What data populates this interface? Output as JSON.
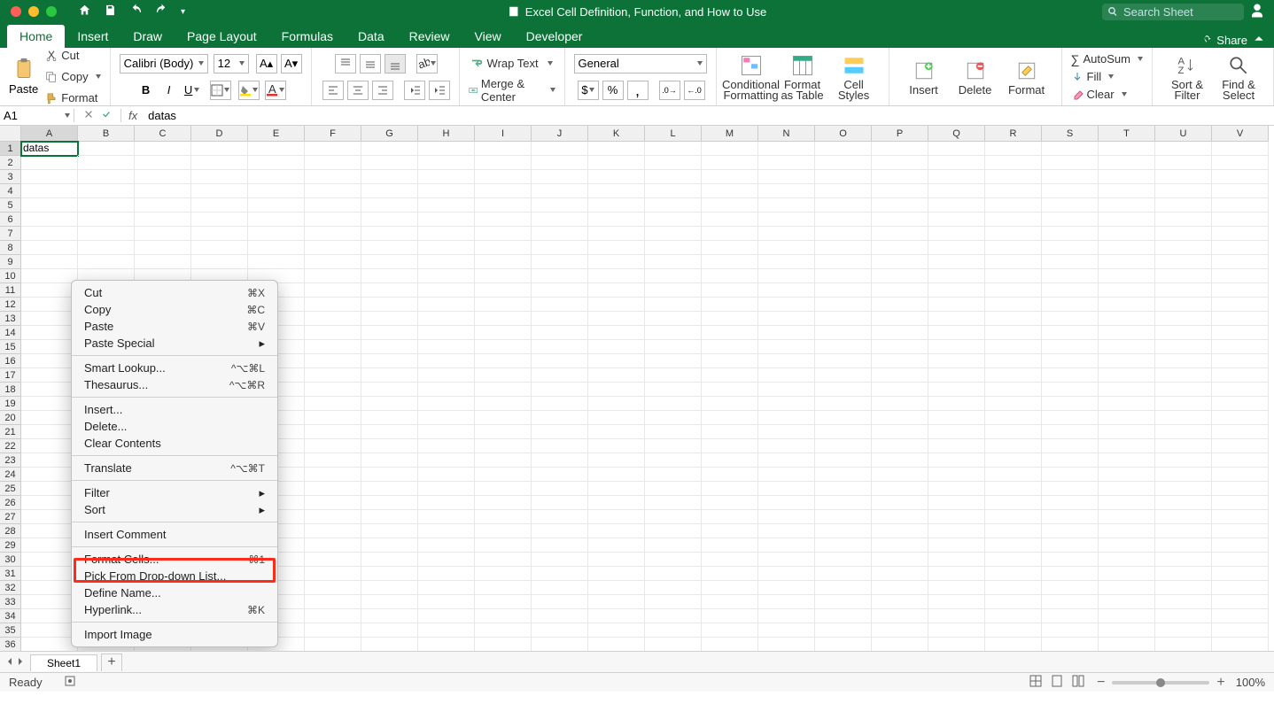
{
  "titlebar": {
    "title": "Excel Cell Definition, Function, and How to Use",
    "search_placeholder": "Search Sheet"
  },
  "tabs": [
    "Home",
    "Insert",
    "Draw",
    "Page Layout",
    "Formulas",
    "Data",
    "Review",
    "View",
    "Developer"
  ],
  "tabs_right": {
    "share": "Share"
  },
  "clipboard": {
    "paste": "Paste",
    "cut": "Cut",
    "copy": "Copy",
    "format": "Format"
  },
  "font": {
    "name": "Calibri (Body)",
    "size": "12"
  },
  "alignment": {
    "wrap": "Wrap Text",
    "merge": "Merge & Center"
  },
  "number": {
    "format": "General"
  },
  "styles": {
    "cond": "Conditional Formatting",
    "table": "Format as Table",
    "cell": "Cell Styles"
  },
  "cells": {
    "insert": "Insert",
    "delete": "Delete",
    "format": "Format"
  },
  "editing": {
    "autosum": "AutoSum",
    "fill": "Fill",
    "clear": "Clear",
    "sort": "Sort & Filter",
    "find": "Find & Select"
  },
  "formula_bar": {
    "name_box": "A1",
    "value": "datas"
  },
  "columns": [
    "A",
    "B",
    "C",
    "D",
    "E",
    "F",
    "G",
    "H",
    "I",
    "J",
    "K",
    "L",
    "M",
    "N",
    "O",
    "P",
    "Q",
    "R",
    "S",
    "T",
    "U",
    "V"
  ],
  "cell_A1": "datas",
  "context_menu": {
    "cut": "Cut",
    "cut_sc": "⌘X",
    "copy": "Copy",
    "copy_sc": "⌘C",
    "pastev": "Paste",
    "paste_sc": "⌘V",
    "paste_special": "Paste Special",
    "smart": "Smart Lookup...",
    "smart_sc": "^⌥⌘L",
    "thes": "Thesaurus...",
    "thes_sc": "^⌥⌘R",
    "insert": "Insert...",
    "delete": "Delete...",
    "clear": "Clear Contents",
    "translate": "Translate",
    "translate_sc": "^⌥⌘T",
    "filter": "Filter",
    "sort": "Sort",
    "comment": "Insert Comment",
    "format_cells": "Format Cells...",
    "format_cells_sc": "⌘1",
    "pick": "Pick From Drop-down List...",
    "define": "Define Name...",
    "link": "Hyperlink...",
    "link_sc": "⌘K",
    "import": "Import Image"
  },
  "tabstrip": {
    "sheet1": "Sheet1"
  },
  "statusbar": {
    "ready": "Ready",
    "zoom": "100%"
  }
}
